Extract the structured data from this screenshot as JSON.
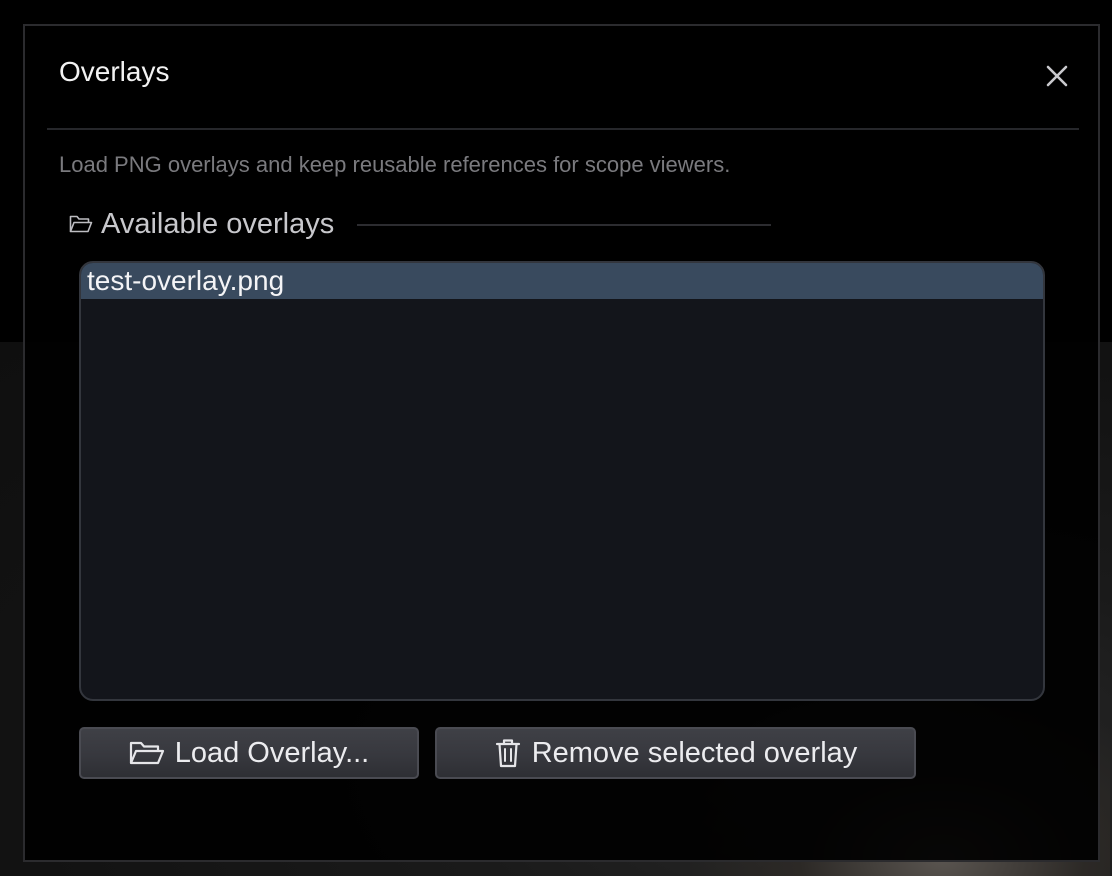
{
  "dialog": {
    "title": "Overlays",
    "close_icon": "close-icon",
    "description": "Load PNG overlays and keep reusable references for scope viewers."
  },
  "overlays_section": {
    "icon": "folder-open-icon",
    "label": "Available overlays",
    "items": [
      {
        "label": "test-overlay.png",
        "selected": true
      }
    ]
  },
  "actions": {
    "load_icon": "folder-open-icon",
    "load_label": "Load Overlay...",
    "remove_icon": "trash-icon",
    "remove_label": "Remove selected overlay"
  },
  "colors": {
    "selection": "#394a5e",
    "list_background": "#13151b",
    "button_face": "#3a3b41"
  }
}
